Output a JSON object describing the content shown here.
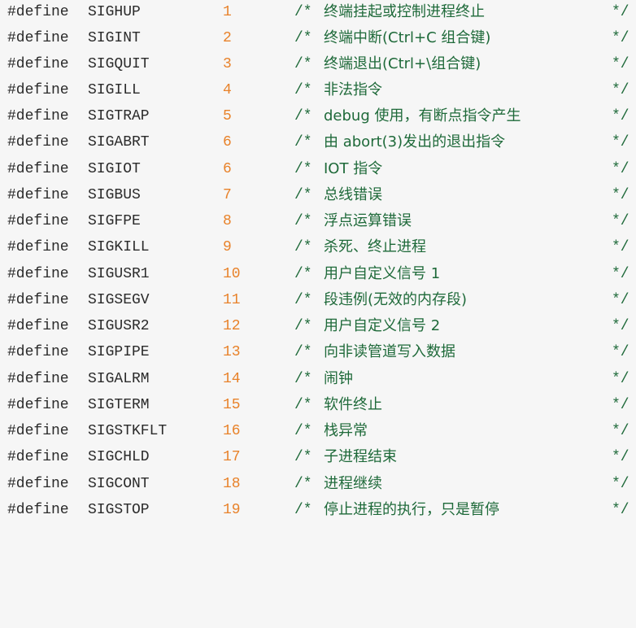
{
  "directive": "#define",
  "comment_open": "/*",
  "comment_close": "*/",
  "colors": {
    "background": "#f6f6f6",
    "text": "#2b2b2b",
    "number": "#e8822a",
    "comment": "#1f6a3a"
  },
  "signals": [
    {
      "name": "SIGHUP",
      "value": "1",
      "comment": "终端挂起或控制进程终止"
    },
    {
      "name": "SIGINT",
      "value": "2",
      "comment": "终端中断(Ctrl+C 组合键)"
    },
    {
      "name": "SIGQUIT",
      "value": "3",
      "comment": "终端退出(Ctrl+\\组合键)"
    },
    {
      "name": "SIGILL",
      "value": "4",
      "comment": "非法指令"
    },
    {
      "name": "SIGTRAP",
      "value": "5",
      "comment": "debug 使用，有断点指令产生"
    },
    {
      "name": "SIGABRT",
      "value": "6",
      "comment": "由 abort(3)发出的退出指令"
    },
    {
      "name": "SIGIOT",
      "value": "6",
      "comment": "IOT 指令"
    },
    {
      "name": "SIGBUS",
      "value": "7",
      "comment": "总线错误"
    },
    {
      "name": "SIGFPE",
      "value": "8",
      "comment": "浮点运算错误"
    },
    {
      "name": "SIGKILL",
      "value": "9",
      "comment": "杀死、终止进程"
    },
    {
      "name": "SIGUSR1",
      "value": "10",
      "comment": "用户自定义信号 1"
    },
    {
      "name": "SIGSEGV",
      "value": "11",
      "comment": "段违例(无效的内存段)"
    },
    {
      "name": "SIGUSR2",
      "value": "12",
      "comment": "用户自定义信号 2"
    },
    {
      "name": "SIGPIPE",
      "value": "13",
      "comment": "向非读管道写入数据"
    },
    {
      "name": "SIGALRM",
      "value": "14",
      "comment": "闹钟"
    },
    {
      "name": "SIGTERM",
      "value": "15",
      "comment": "软件终止"
    },
    {
      "name": "SIGSTKFLT",
      "value": "16",
      "comment": "栈异常"
    },
    {
      "name": "SIGCHLD",
      "value": "17",
      "comment": "子进程结束"
    },
    {
      "name": "SIGCONT",
      "value": "18",
      "comment": "进程继续"
    },
    {
      "name": "SIGSTOP",
      "value": "19",
      "comment": "停止进程的执行，只是暂停"
    }
  ]
}
